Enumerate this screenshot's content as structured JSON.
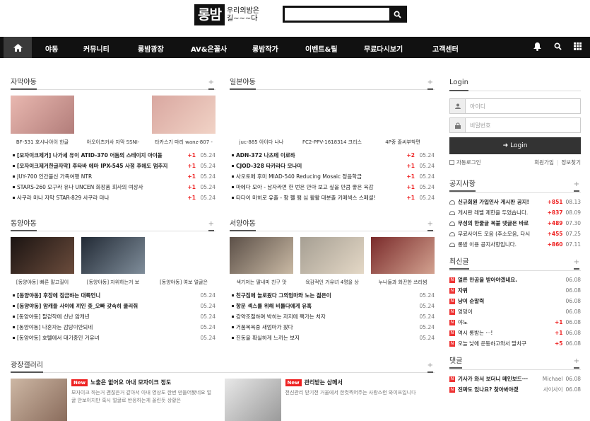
{
  "header": {
    "logo_main": "롱밤",
    "logo_sub": "우리의밤은 길~~~다",
    "search_placeholder": ""
  },
  "nav": {
    "items": [
      "야동",
      "커뮤니티",
      "롱밤광장",
      "AV&은꼴사",
      "롱밤작가",
      "이벤트&릴",
      "무료다시보기",
      "고객센터"
    ]
  },
  "colors": {
    "accent": "#e22222",
    "nav_bg": "#111111"
  },
  "sub_yadong": {
    "title": "자막야동",
    "thumbs": [
      "BF-531 호시나아이 한글",
      "아오이츠카사 자막 SSNI-",
      "타카스기 마리 wanz-807 -"
    ],
    "rows": [
      {
        "t": "[모자이크제거] 나가세 유이 ATID-370 어둠의 스테이지 아이돌",
        "c": "+1",
        "d": "05.24",
        "b": true
      },
      {
        "t": "[모자이크제거한글자막] 후타바 에마 IPX-545 사정 후에도 멈추지",
        "c": "+1",
        "d": "05.24",
        "b": true
      },
      {
        "t": "JUY-700 인간불신 가족여행 NTR",
        "c": "+1",
        "d": "05.24",
        "b": false
      },
      {
        "t": "STARS-260 모구라 유나 UNCEN 화장품 회사의 여상사",
        "c": "+1",
        "d": "05.24",
        "b": false
      },
      {
        "t": "사쿠라 마나 자막 STAR-829 사쿠라 마나",
        "c": "+1",
        "d": "05.24",
        "b": false
      }
    ]
  },
  "jp_yadong": {
    "title": "일본야동",
    "thumbs": [
      "juc-885 아이다 나나",
      "FC2-PPV-1618314 크리스",
      "4P중 줄씨부착편"
    ],
    "rows": [
      {
        "t": "ADN-372 나츠메 이로하",
        "c": "+2",
        "d": "05.24",
        "b": true
      },
      {
        "t": "CJOD-328 타카라다 모나미",
        "c": "+1",
        "d": "05.24",
        "b": true
      },
      {
        "t": "사오토메 후미 MIAD-540 Reducing Mosaic 정음학급",
        "c": "+1",
        "d": "05.24",
        "b": false
      },
      {
        "t": "마에다 모아 - 남자라면 한 번은 안아 보고 싶을 만큼 좋은 육감",
        "c": "+1",
        "d": "05.24",
        "b": false
      },
      {
        "t": "타다이 마히로 유출 - 팜 펠 팸 심 활활 대분출 키메섹스 스페셜!",
        "c": "+1",
        "d": "05.24",
        "b": false
      }
    ]
  },
  "east_yadong": {
    "title": "동양야동",
    "thumbs": [
      "[동양야동] 빠른 말고질이",
      "[동양야동] 자위하는거 보",
      "[동양야동] 여보 얼굴은"
    ],
    "rows": [
      {
        "t": "[동양야동] 후장에 집금하는 대륙언니",
        "c": "",
        "d": "05.24",
        "b": true
      },
      {
        "t": "[동양야동] 암캐들 사이에 끼인 좆_오빠 갖속히 쿨리줘",
        "c": "",
        "d": "05.24",
        "b": true
      },
      {
        "t": "[동양야동] 팔걷작에 신난 암캐년",
        "c": "",
        "d": "05.24",
        "b": false
      },
      {
        "t": "[동양야동] 나혼자는 감당이안되네",
        "c": "",
        "d": "05.24",
        "b": false
      },
      {
        "t": "[동양야동] 호텔에서 대기중인 거유녀",
        "c": "",
        "d": "05.24",
        "b": false
      }
    ]
  },
  "west_yadong": {
    "title": "서양야동",
    "thumbs": [
      "색기저는 딸내미 친구 맛",
      "육감적인 거유녀 4명을 상",
      "누나들과 화끈한 쓰리썸"
    ],
    "rows": [
      {
        "t": "친구집에 놀로왔다 그의엄마와 노는 젊은이",
        "c": "",
        "d": "05.24",
        "b": true
      },
      {
        "t": "항문 섹스를 위해 비틀다에게 유혹",
        "c": "",
        "d": "05.24",
        "b": true
      },
      {
        "t": "강약조절하며 박히는 자지에 팩가는 처자",
        "c": "",
        "d": "05.24",
        "b": false
      },
      {
        "t": "거품목욕중 새엄마가 왔다",
        "c": "",
        "d": "05.24",
        "b": false
      },
      {
        "t": "진동을 확실하게 느끼는 보지",
        "c": "",
        "d": "05.24",
        "b": false
      }
    ]
  },
  "gallery": {
    "title": "광장갤러리",
    "items": [
      {
        "badge": "New",
        "title": "노출은 없어요 아내 모자이크 정도",
        "text": "모자이크 하는거 괜찮은거 같아서 아내 영상도 한번 만들어봤네요 얼굴 안보이지만 혹시 얼굴로 반응하는게 꼴린듯 상황은"
      },
      {
        "badge": "New",
        "title": "관리받는 삼메서",
        "text": "전신관리 받기전 거울에서 한컷찍어주는 사랑스런 와이프입니다"
      }
    ]
  },
  "login": {
    "title": "Login",
    "id_placeholder": "아이디",
    "pw_placeholder": "비밀번호",
    "button": "Login",
    "auto_login": "자동로그인",
    "join": "회원가입",
    "find": "정보찾기"
  },
  "notice": {
    "title": "공지사항",
    "rows": [
      {
        "t": "신규회원 가입인사 게시판 공지!",
        "c": "+851",
        "d": "08.13",
        "b": true
      },
      {
        "t": "게시판 레벨 제한을 두었습니다.",
        "c": "+837",
        "d": "08.09",
        "b": false
      },
      {
        "t": "무성의 한줄글 복붙 댓글은 바로",
        "c": "+489",
        "d": "07.30",
        "b": true
      },
      {
        "t": "무료사이트 모음 (주소모음, 다시",
        "c": "+455",
        "d": "07.25",
        "b": false
      },
      {
        "t": "롱밤 이용 공지사항입니다.",
        "c": "+860",
        "d": "07.11",
        "b": false
      }
    ]
  },
  "latest": {
    "title": "최신글",
    "rows": [
      {
        "t": "얼른 만곰을 받아야겠네요.",
        "c": "",
        "d": "06.08",
        "b": true
      },
      {
        "t": "자위",
        "c": "",
        "d": "06.08",
        "b": true
      },
      {
        "t": "냥이 순말력",
        "c": "",
        "d": "06.08",
        "b": true
      },
      {
        "t": "엉덩이",
        "c": "",
        "d": "06.08",
        "b": false
      },
      {
        "t": "야노",
        "c": "+1",
        "d": "06.08",
        "b": false
      },
      {
        "t": "역시 롱밤는 ···!",
        "c": "+1",
        "d": "06.08",
        "b": false
      },
      {
        "t": "오늘 낮에 운동하고와서 딸치구",
        "c": "+5",
        "d": "06.08",
        "b": false
      }
    ]
  },
  "comments": {
    "title": "댓글",
    "rows": [
      {
        "t": "기사가 와서 보더니 메인보드···",
        "c": "Michael",
        "d": "06.08",
        "b": true
      },
      {
        "t": "진짜도 있나요? 찾아봐야겠",
        "c": "사이사이",
        "d": "06.08",
        "b": true
      }
    ]
  }
}
